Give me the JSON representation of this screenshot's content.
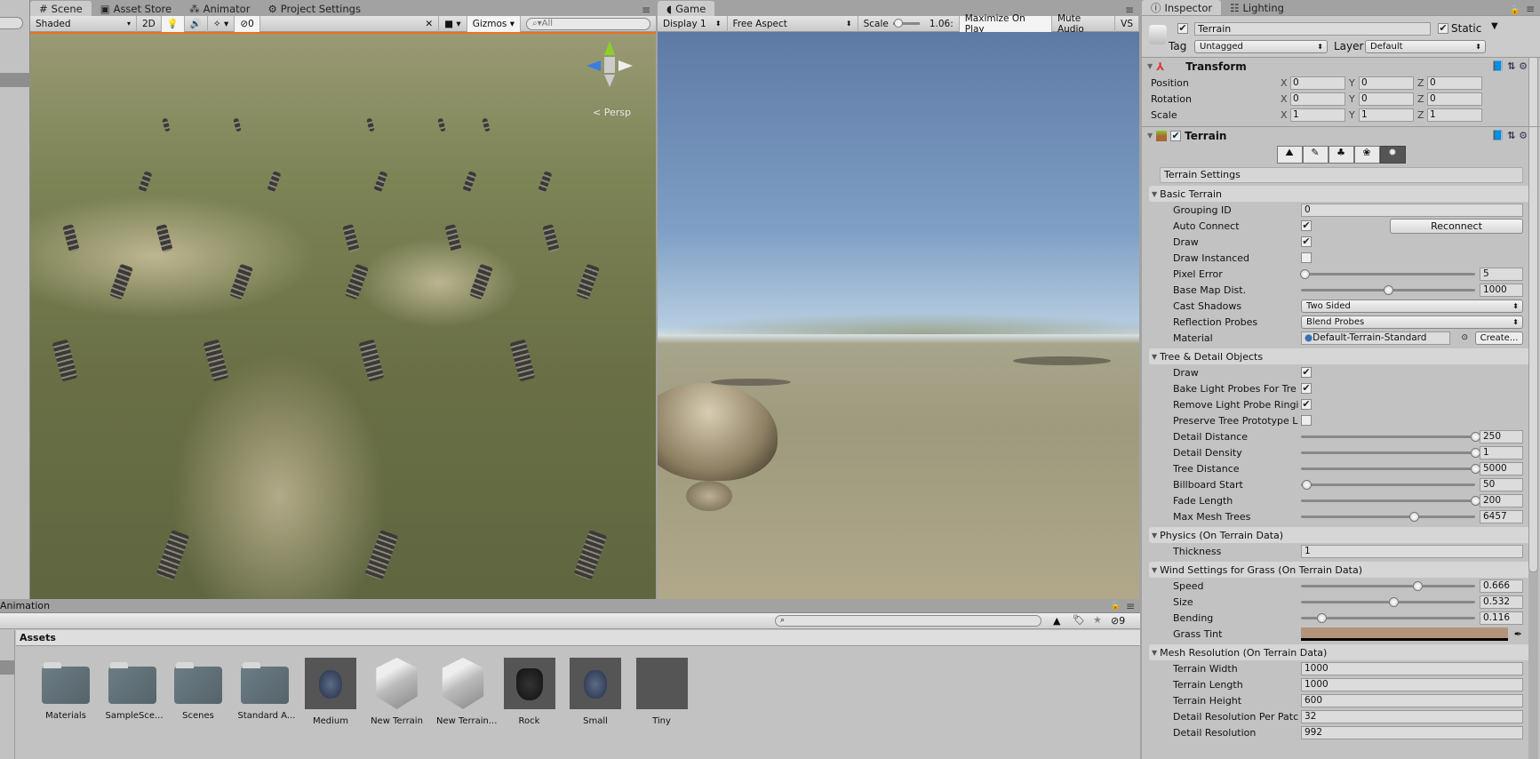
{
  "scene_panel": {
    "tabs": [
      {
        "label": "Scene",
        "icon": "hash-icon"
      },
      {
        "label": "Asset Store",
        "icon": "bag-icon"
      },
      {
        "label": "Animator",
        "icon": "nodes-icon"
      },
      {
        "label": "Project Settings",
        "icon": "gear-icon"
      }
    ],
    "shading_mode": "Shaded",
    "mode_2d": "2D",
    "hidden_count": "0",
    "gizmos_label": "Gizmos",
    "search_placeholder": "All",
    "persp_label": "< Persp"
  },
  "game_panel": {
    "tab_label": "Game",
    "display": "Display 1",
    "aspect": "Free Aspect",
    "scale_label": "Scale",
    "scale_value": "1.06:",
    "scale_fraction": 0.05,
    "maximize_on_play": "Maximize On Play",
    "mute_audio": "Mute Audio",
    "vs_label": "VS"
  },
  "inspector": {
    "tabs": [
      {
        "label": "Inspector"
      },
      {
        "label": "Lighting"
      }
    ],
    "object_name": "Terrain",
    "active": true,
    "static_label": "Static",
    "tag_label": "Tag",
    "tag_value": "Untagged",
    "layer_label": "Layer",
    "layer_value": "Default",
    "transform": {
      "title": "Transform",
      "rows": [
        {
          "label": "Position",
          "x": "0",
          "y": "0",
          "z": "0"
        },
        {
          "label": "Rotation",
          "x": "0",
          "y": "0",
          "z": "0"
        },
        {
          "label": "Scale",
          "x": "1",
          "y": "1",
          "z": "1"
        }
      ]
    },
    "terrain": {
      "title": "Terrain",
      "settings_title": "Terrain Settings",
      "basic": {
        "title": "Basic Terrain",
        "grouping_id": {
          "label": "Grouping ID",
          "value": "0"
        },
        "auto_connect": {
          "label": "Auto Connect",
          "checked": true
        },
        "reconnect_label": "Reconnect",
        "draw": {
          "label": "Draw",
          "checked": true
        },
        "draw_instanced": {
          "label": "Draw Instanced",
          "checked": false
        },
        "pixel_error": {
          "label": "Pixel Error",
          "value": "5",
          "fraction": 0.02
        },
        "base_map_dist": {
          "label": "Base Map Dist.",
          "value": "1000",
          "fraction": 0.5
        },
        "cast_shadows": {
          "label": "Cast Shadows",
          "value": "Two Sided"
        },
        "reflection_probes": {
          "label": "Reflection Probes",
          "value": "Blend Probes"
        },
        "material": {
          "label": "Material",
          "value": "Default-Terrain-Standard",
          "create_label": "Create..."
        }
      },
      "tree_detail": {
        "title": "Tree & Detail Objects",
        "checks": [
          {
            "label": "Draw",
            "checked": true
          },
          {
            "label": "Bake Light Probes For Tre",
            "checked": true
          },
          {
            "label": "Remove Light Probe Ringi",
            "checked": true
          },
          {
            "label": "Preserve Tree Prototype L",
            "checked": false
          }
        ],
        "sliders": [
          {
            "label": "Detail Distance",
            "value": "250",
            "fraction": 1.0
          },
          {
            "label": "Detail Density",
            "value": "1",
            "fraction": 1.0
          },
          {
            "label": "Tree Distance",
            "value": "5000",
            "fraction": 1.0
          },
          {
            "label": "Billboard Start",
            "value": "50",
            "fraction": 0.03
          },
          {
            "label": "Fade Length",
            "value": "200",
            "fraction": 1.0
          },
          {
            "label": "Max Mesh Trees",
            "value": "6457",
            "fraction": 0.65
          }
        ]
      },
      "physics": {
        "title": "Physics (On Terrain Data)",
        "thickness": {
          "label": "Thickness",
          "value": "1"
        }
      },
      "wind": {
        "title": "Wind Settings for Grass (On Terrain Data)",
        "sliders": [
          {
            "label": "Speed",
            "value": "0.666",
            "fraction": 0.666
          },
          {
            "label": "Size",
            "value": "0.532",
            "fraction": 0.532
          },
          {
            "label": "Bending",
            "value": "0.116",
            "fraction": 0.116
          }
        ],
        "grass_tint": {
          "label": "Grass Tint",
          "color": "#b3937a"
        }
      },
      "mesh": {
        "title": "Mesh Resolution (On Terrain Data)",
        "rows": [
          {
            "label": "Terrain Width",
            "value": "1000"
          },
          {
            "label": "Terrain Length",
            "value": "1000"
          },
          {
            "label": "Terrain Height",
            "value": "600"
          },
          {
            "label": "Detail Resolution Per Patc",
            "value": "32"
          },
          {
            "label": "Detail Resolution",
            "value": "992"
          }
        ]
      }
    }
  },
  "project": {
    "tab_label": "Animation",
    "hidden_count": "9",
    "breadcrumb": "Assets",
    "assets": [
      {
        "name": "Materials",
        "type": "folder"
      },
      {
        "name": "SampleSce...",
        "type": "folder"
      },
      {
        "name": "Scenes",
        "type": "folder"
      },
      {
        "name": "Standard A...",
        "type": "folder"
      },
      {
        "name": "Medium",
        "type": "rock"
      },
      {
        "name": "New Terrain",
        "type": "terrain"
      },
      {
        "name": "New Terrain...",
        "type": "terrain"
      },
      {
        "name": "Rock",
        "type": "mesh"
      },
      {
        "name": "Small",
        "type": "rock"
      },
      {
        "name": "Tiny",
        "type": "empty"
      }
    ]
  }
}
